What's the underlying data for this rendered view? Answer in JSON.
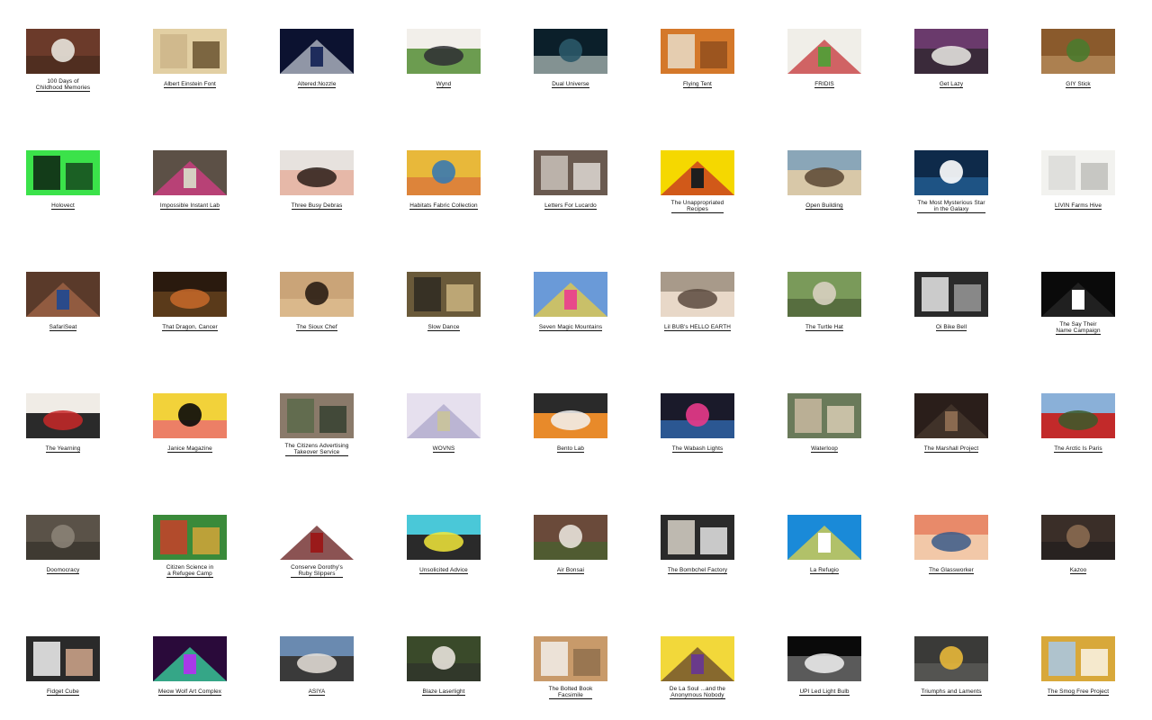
{
  "projects": [
    {
      "title": "100 Days of\nChildhood Memories",
      "colors": [
        "#6b3a2a",
        "#e8e4dc",
        "#3b2418"
      ]
    },
    {
      "title": "Albert Einstein Font",
      "colors": [
        "#cdb58a",
        "#e2cfa3",
        "#5a4320"
      ]
    },
    {
      "title": "Altered:Nozzle",
      "colors": [
        "#0c1230",
        "#1e2c5c",
        "#c9ced8"
      ]
    },
    {
      "title": "Wynd",
      "colors": [
        "#f2efea",
        "#2e2e32",
        "#6c9c50"
      ]
    },
    {
      "title": "Dual Universe",
      "colors": [
        "#0b1f2a",
        "#2a5868",
        "#e8f0e8"
      ]
    },
    {
      "title": "Flying Tent",
      "colors": [
        "#e8dcc8",
        "#d4782a",
        "#8a4a1c"
      ]
    },
    {
      "title": "FRIDIS",
      "colors": [
        "#f0eee8",
        "#5a9a3a",
        "#c2282c"
      ]
    },
    {
      "title": "Get Lazy",
      "colors": [
        "#6a3a6c",
        "#ecebe6",
        "#3a2a3a"
      ]
    },
    {
      "title": "GIY Stick",
      "colors": [
        "#8a5a2c",
        "#4a7a2e",
        "#c8a070"
      ]
    },
    {
      "title": "Holovect",
      "colors": [
        "#0d1f10",
        "#3be24a",
        "#123418"
      ]
    },
    {
      "title": "Impossible Instant Lab",
      "colors": [
        "#5c5046",
        "#d6cfc2",
        "#e03a8a"
      ]
    },
    {
      "title": "Three Busy Debras",
      "colors": [
        "#e7e2de",
        "#2a1c18",
        "#e6b8a8"
      ]
    },
    {
      "title": "Habitats Fabric Collection",
      "colors": [
        "#e8b83a",
        "#3a7ab0",
        "#d45a3a"
      ]
    },
    {
      "title": "Letters For Lucardo",
      "colors": [
        "#c9c2ba",
        "#6a5a50",
        "#efebe6"
      ]
    },
    {
      "title": "The Unappropriated\nRecipes",
      "colors": [
        "#f5d800",
        "#1e1e1e",
        "#c22424"
      ]
    },
    {
      "title": "Open Building",
      "colors": [
        "#8aa6b8",
        "#5a4632",
        "#d8c8a8"
      ]
    },
    {
      "title": "The Most Mysterious Star\nin the Galaxy",
      "colors": [
        "#0e2a4a",
        "#ffffff",
        "#2c74b4"
      ]
    },
    {
      "title": "LIVIN Farms Hive",
      "colors": [
        "#dcdcd8",
        "#f2f2ef",
        "#b8b8b4"
      ]
    },
    {
      "title": "SafariSeat",
      "colors": [
        "#5a3a2a",
        "#2a4a8a",
        "#a86a4a"
      ]
    },
    {
      "title": "That Dragon, Cancer",
      "colors": [
        "#2a1a0e",
        "#c86a2a",
        "#5a3a1a"
      ]
    },
    {
      "title": "The Sioux Chef",
      "colors": [
        "#caa478",
        "#2a1e14",
        "#e8c89a"
      ]
    },
    {
      "title": "Slow Dance",
      "colors": [
        "#2e2a22",
        "#6a5a3a",
        "#d8c08a"
      ]
    },
    {
      "title": "Seven Magic Mountains",
      "colors": [
        "#6a9ad8",
        "#e84a8a",
        "#f2d03a"
      ]
    },
    {
      "title": "Lil BUB's HELLO EARTH",
      "colors": [
        "#a89a8a",
        "#5a4a3e",
        "#e8d8c8"
      ]
    },
    {
      "title": "The Turtle Hat",
      "colors": [
        "#7a9a5a",
        "#d8d0c0",
        "#3a4a2a"
      ]
    },
    {
      "title": "Oi Bike Bell",
      "colors": [
        "#e8e8e8",
        "#2a2a2a",
        "#a8a8a8"
      ]
    },
    {
      "title": "The Say Their\nName Campaign",
      "colors": [
        "#0a0a0a",
        "#ffffff",
        "#2a2a2a"
      ]
    },
    {
      "title": "The Yearning",
      "colors": [
        "#f0ece6",
        "#c82828",
        "#2a2a2a"
      ]
    },
    {
      "title": "Janice Magazine",
      "colors": [
        "#f2d23a",
        "#0a0a0a",
        "#e83a8a"
      ]
    },
    {
      "title": "The Citizens Advertising\nTakeover Service",
      "colors": [
        "#5a6a4a",
        "#8a7a6a",
        "#2a3a2a"
      ]
    },
    {
      "title": "WOVNS",
      "colors": [
        "#e6e0ee",
        "#c8c2a0",
        "#a8a2c8"
      ]
    },
    {
      "title": "Bento Lab",
      "colors": [
        "#2a2a2a",
        "#f2f2f2",
        "#e88a2a"
      ]
    },
    {
      "title": "The Wabash Lights",
      "colors": [
        "#1a1a2a",
        "#e83a8a",
        "#3a8ae8"
      ]
    },
    {
      "title": "Waterloop",
      "colors": [
        "#c8b8a0",
        "#6a7a5a",
        "#e8d8c0"
      ]
    },
    {
      "title": "The Marshall Project",
      "colors": [
        "#2a1e1a",
        "#8a6a50",
        "#4a3a30"
      ]
    },
    {
      "title": "The Arctic Is Paris",
      "colors": [
        "#8ab0d8",
        "#3a5a2a",
        "#c22a2a"
      ]
    },
    {
      "title": "Doomocracy",
      "colors": [
        "#5a5248",
        "#8a8276",
        "#2a2620"
      ]
    },
    {
      "title": "Citizen Science in\na Refugee Camp",
      "colors": [
        "#c8402a",
        "#3a8a3a",
        "#e8a83a"
      ]
    },
    {
      "title": "Conserve Dorothy's\nRuby Slippers",
      "colors": [
        "#ffffff",
        "#9a1a1a",
        "#5a0a0a"
      ]
    },
    {
      "title": "Unsolicited Advice",
      "colors": [
        "#4ac8d8",
        "#f2e83a",
        "#2a2a2a"
      ]
    },
    {
      "title": "Air Bonsai",
      "colors": [
        "#6a4a3a",
        "#e8e2da",
        "#3a6a2a"
      ]
    },
    {
      "title": "The Bombchel Factory",
      "colors": [
        "#d8d2c8",
        "#2a2a2a",
        "#ffffff"
      ]
    },
    {
      "title": "La Refugio",
      "colors": [
        "#1a8ad8",
        "#ffffff",
        "#f2d83a"
      ]
    },
    {
      "title": "The Glassworker",
      "colors": [
        "#e88a6a",
        "#3a5a8a",
        "#f2c8a8"
      ]
    },
    {
      "title": "Kazoo",
      "colors": [
        "#3a2e28",
        "#8a6a50",
        "#1a1a1a"
      ]
    },
    {
      "title": "Fidget Cube",
      "colors": [
        "#f2f2f2",
        "#2a2a2a",
        "#e8b89a"
      ]
    },
    {
      "title": "Meow Wolf Art Complex",
      "colors": [
        "#2a0a3a",
        "#a83ae8",
        "#3ae8a8"
      ]
    },
    {
      "title": "ASIYA",
      "colors": [
        "#6a8ab0",
        "#e8e2da",
        "#3a3a3a"
      ]
    },
    {
      "title": "Blaze Laserlight",
      "colors": [
        "#3a4a2a",
        "#e8e2da",
        "#2a2a2a"
      ]
    },
    {
      "title": "The Bolted Book\nFacsimile",
      "colors": [
        "#f2efea",
        "#c89a6a",
        "#8a6a4a"
      ]
    },
    {
      "title": "De La Soul ...and the\nAnonymous Nobody",
      "colors": [
        "#f2d83a",
        "#6a3a8a",
        "#5a3a2a"
      ]
    },
    {
      "title": "UPI Led Light Bulb",
      "colors": [
        "#0a0a0a",
        "#f2f2f2",
        "#5a5a5a"
      ]
    },
    {
      "title": "Triumphs and Laments",
      "colors": [
        "#3a3a38",
        "#e8b83a",
        "#6a6a66"
      ]
    },
    {
      "title": "The Smog Free Project",
      "colors": [
        "#a8c8e8",
        "#d8a83a",
        "#ffffff"
      ]
    }
  ]
}
